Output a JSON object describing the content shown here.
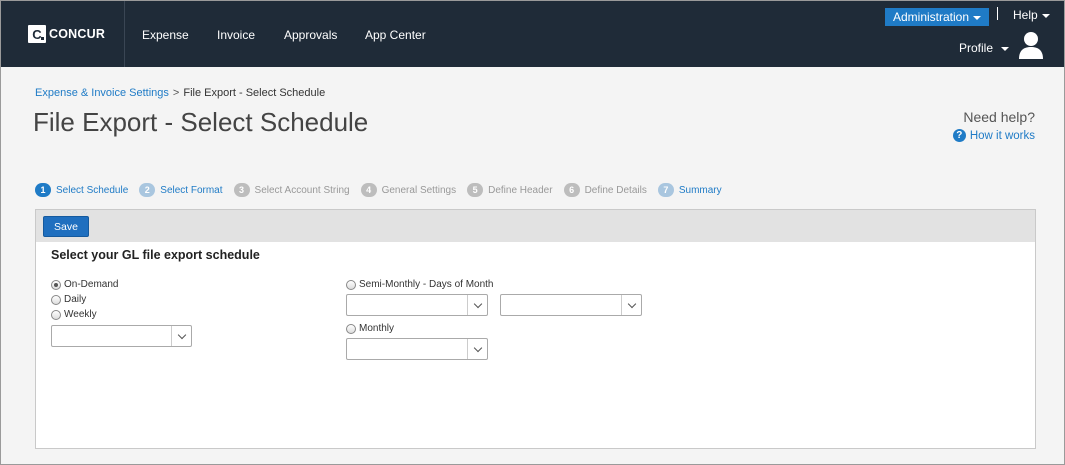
{
  "nav": {
    "logo_mark": "C",
    "logo_text": "CONCUR",
    "items": [
      "Expense",
      "Invoice",
      "Approvals",
      "App Center"
    ],
    "admin_label": "Administration",
    "help_label": "Help",
    "profile_label": "Profile"
  },
  "breadcrumb": {
    "parent": "Expense & Invoice Settings",
    "separator": ">",
    "current": "File Export - Select Schedule"
  },
  "page_title": "File Export - Select Schedule",
  "help": {
    "need_help": "Need help?",
    "icon_glyph": "?",
    "how_it_works": "How it works"
  },
  "steps": [
    {
      "num": "1",
      "label": "Select Schedule",
      "state": "active"
    },
    {
      "num": "2",
      "label": "Select Format",
      "state": "link"
    },
    {
      "num": "3",
      "label": "Select Account String",
      "state": "disabled"
    },
    {
      "num": "4",
      "label": "General Settings",
      "state": "disabled"
    },
    {
      "num": "5",
      "label": "Define Header",
      "state": "disabled"
    },
    {
      "num": "6",
      "label": "Define Details",
      "state": "disabled"
    },
    {
      "num": "7",
      "label": "Summary",
      "state": "link"
    }
  ],
  "toolbar": {
    "save_label": "Save"
  },
  "form": {
    "title": "Select your GL file export schedule",
    "options": {
      "on_demand": "On-Demand",
      "daily": "Daily",
      "weekly": "Weekly",
      "semi_monthly": "Semi-Monthly - Days of Month",
      "monthly": "Monthly"
    },
    "selected": "On-Demand"
  },
  "colors": {
    "nav_bg": "#1f2b38",
    "accent": "#1f7bc6"
  }
}
